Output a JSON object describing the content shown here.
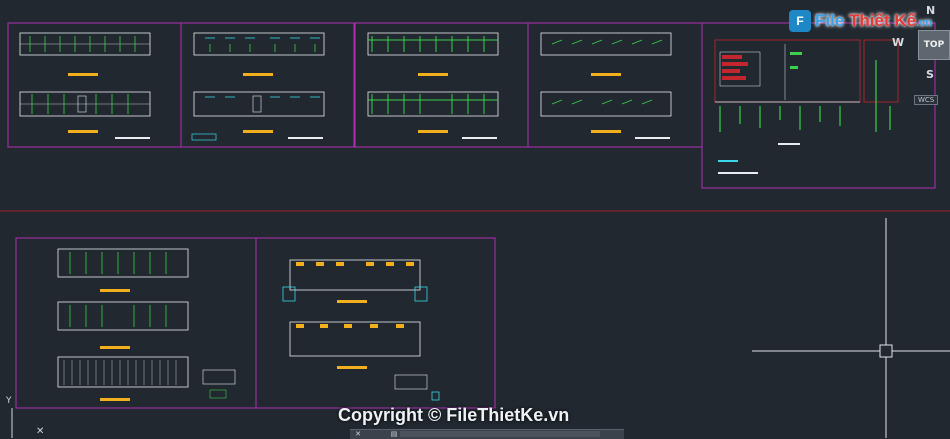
{
  "logo": {
    "mark": "F",
    "name_part1": "File",
    "name_part2": "Thiết Kế",
    "domain": ".vn"
  },
  "viewcube": {
    "top_label": "TOP",
    "north": "N",
    "south": "S",
    "west": "W",
    "wcs_label": "WCS"
  },
  "watermark": "Copyright © FileThietKe.vn",
  "ucs": {
    "y_label": "Y",
    "x_label": "✕"
  },
  "command_line": {
    "value": "",
    "close_icon": "✕",
    "settings_icon": "▤"
  },
  "colors": {
    "background": "#212830",
    "sheet_border": "#b12fb5",
    "red_axis": "#a41f2b",
    "title_bar": "#f2b01e",
    "wall_white": "#e8ecef",
    "dim_green": "#3bd14a",
    "cyan": "#3ad7e8",
    "crosshair": "#dfe4e8"
  }
}
